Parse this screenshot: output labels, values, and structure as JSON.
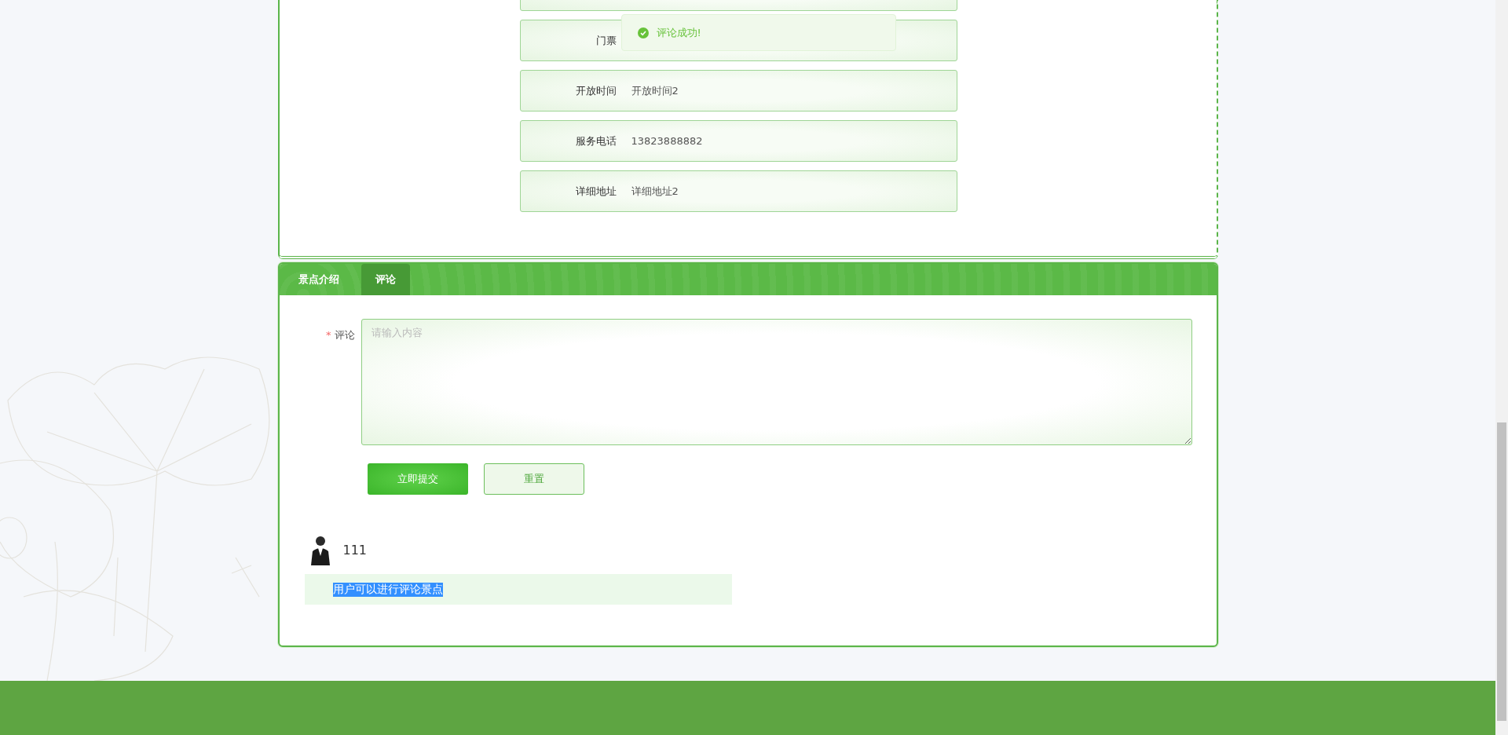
{
  "detail": {
    "rows": [
      {
        "label": "门票"
      },
      {
        "label": "开放时间",
        "value": "开放时间2"
      },
      {
        "label": "服务电话",
        "value": "13823888882"
      },
      {
        "label": "详细地址",
        "value": "详细地址2"
      }
    ]
  },
  "toast": {
    "kind": "success",
    "text": "评论成功!"
  },
  "tabs": [
    {
      "label": "景点介绍",
      "selected": false
    },
    {
      "label": "评论",
      "selected": true
    }
  ],
  "form": {
    "label": "评论",
    "required_mark": "*",
    "placeholder": "请输入内容",
    "buttons": [
      {
        "label": "立即提交",
        "kind": "primary"
      },
      {
        "label": "重置",
        "kind": "secondary"
      }
    ]
  },
  "comments": [
    {
      "user": "111",
      "content": "用户可以进行评论景点",
      "highlighted": true
    }
  ]
}
